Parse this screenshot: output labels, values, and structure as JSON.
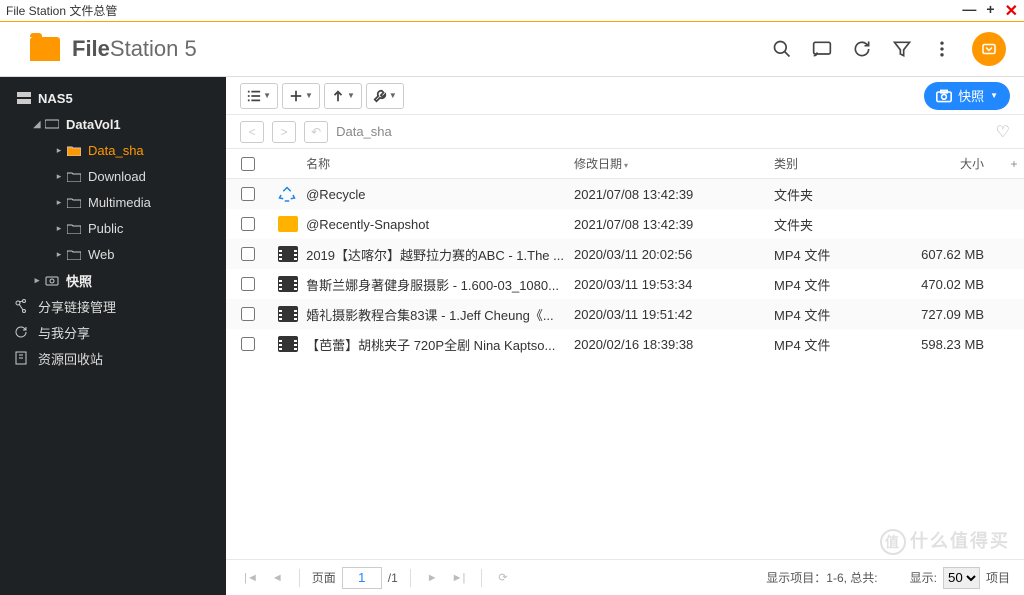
{
  "window": {
    "title": "File Station 文件总管"
  },
  "logo": {
    "name": "File",
    "suffix": "Station 5"
  },
  "sidebar": {
    "root": "NAS5",
    "volume": "DataVol1",
    "folders": [
      {
        "label": "Data_sha",
        "selected": true
      },
      {
        "label": "Download",
        "selected": false
      },
      {
        "label": "Multimedia",
        "selected": false
      },
      {
        "label": "Public",
        "selected": false
      },
      {
        "label": "Web",
        "selected": false
      }
    ],
    "snapshot": "快照",
    "extra": [
      {
        "label": "分享链接管理"
      },
      {
        "label": "与我分享"
      },
      {
        "label": "资源回收站"
      }
    ]
  },
  "snapshot_button": "快照",
  "path": {
    "current": "Data_sha"
  },
  "columns": {
    "name": "名称",
    "date": "修改日期",
    "type": "类别",
    "size": "大小"
  },
  "files": [
    {
      "icon": "recycle",
      "name": "@Recycle",
      "date": "2021/07/08 13:42:39",
      "type": "文件夹",
      "size": ""
    },
    {
      "icon": "folder",
      "name": "@Recently-Snapshot",
      "date": "2021/07/08 13:42:39",
      "type": "文件夹",
      "size": ""
    },
    {
      "icon": "video",
      "name": "2019【达喀尔】越野拉力赛的ABC - 1.The ...",
      "date": "2020/03/11 20:02:56",
      "type": "MP4 文件",
      "size": "607.62 MB"
    },
    {
      "icon": "video",
      "name": "鲁斯兰娜身著健身服摄影 - 1.600-03_1080...",
      "date": "2020/03/11 19:53:34",
      "type": "MP4 文件",
      "size": "470.02 MB"
    },
    {
      "icon": "video",
      "name": "婚礼摄影教程合集83课 -  1.Jeff Cheung《...",
      "date": "2020/03/11 19:51:42",
      "type": "MP4 文件",
      "size": "727.09 MB"
    },
    {
      "icon": "video",
      "name": "【芭蕾】胡桃夹子 720P全剧 Nina Kaptso...",
      "date": "2020/02/16 18:39:38",
      "type": "MP4 文件",
      "size": "598.23 MB"
    }
  ],
  "footer": {
    "page_label": "页面",
    "page_current": "1",
    "page_total": "/1",
    "status": "显示项目：1-6, 总共:",
    "show_label": "显示:",
    "per_page": "50",
    "items_label": "项目"
  },
  "watermark": "什么值得买"
}
